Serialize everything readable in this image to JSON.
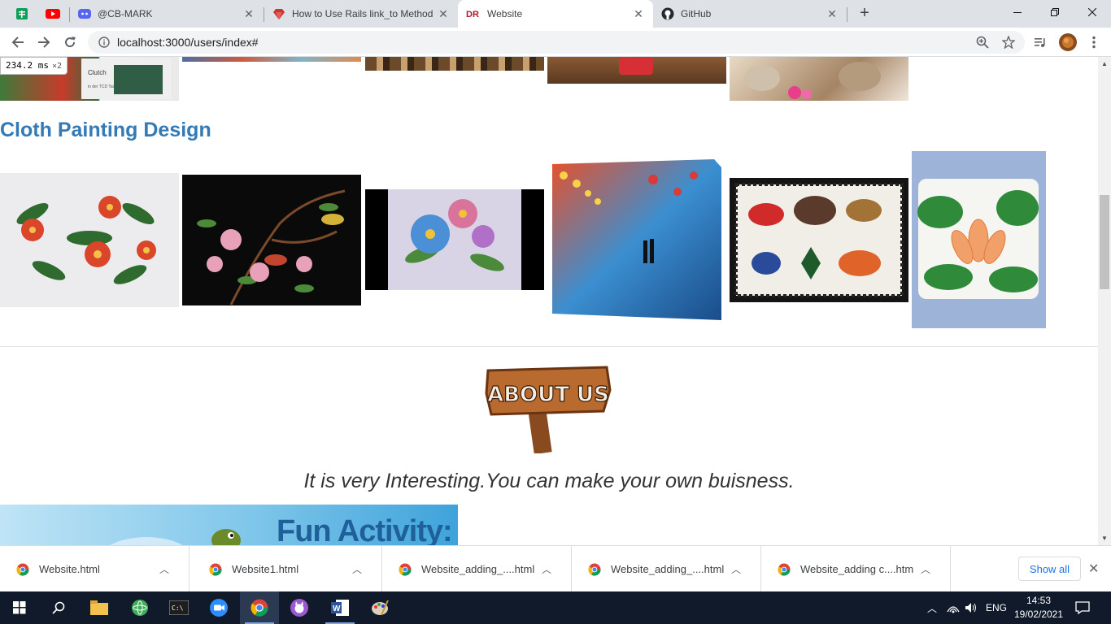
{
  "browser": {
    "pinned_tabs": [
      {
        "name": "google-sheets-tab",
        "icon": "sheets-icon"
      },
      {
        "name": "youtube-tab",
        "icon": "youtube-icon"
      }
    ],
    "tabs": [
      {
        "title": "@CB-MARK",
        "icon": "discord-icon",
        "active": false
      },
      {
        "title": "How to Use Rails link_to Method",
        "icon": "ruby-gem-icon",
        "active": false
      },
      {
        "title": "Website",
        "icon": "dr-logo-icon",
        "active": true
      },
      {
        "title": "GitHub",
        "icon": "github-icon",
        "active": false
      }
    ],
    "url": "localhost:3000/users/index#"
  },
  "page": {
    "perf_label": "234.2 ms",
    "perf_multiplier": "×2",
    "section_title": "Cloth Painting Design",
    "about_sign_text": "ABOUT US",
    "tagline": "It is very Interesting.You can make your own buisness.",
    "fun_banner_text": "Fun Activity:"
  },
  "downloads": {
    "items": [
      {
        "name": "Website.html"
      },
      {
        "name": "Website1.html"
      },
      {
        "name": "Website_adding_....html"
      },
      {
        "name": "Website_adding_....html"
      },
      {
        "name": "Website_adding c....html"
      }
    ],
    "show_all": "Show all"
  },
  "taskbar": {
    "language": "ENG",
    "time": "14:53",
    "date": "19/02/2021"
  }
}
